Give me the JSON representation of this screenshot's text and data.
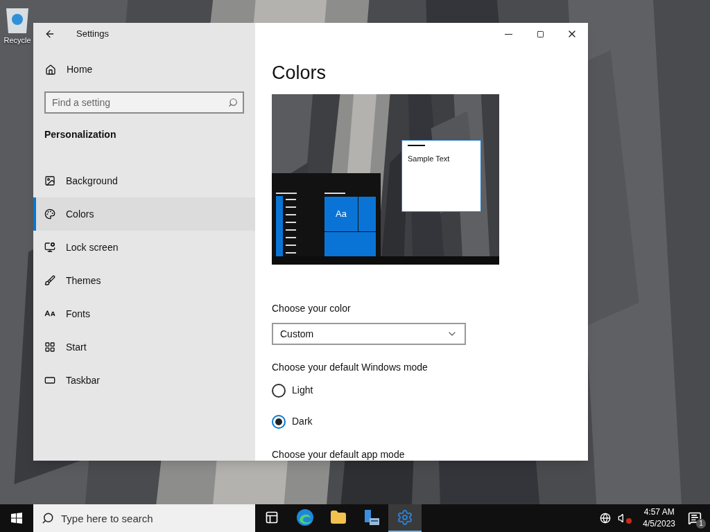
{
  "desktop_icons": [
    {
      "label": "Recycle"
    }
  ],
  "window": {
    "title": "Settings"
  },
  "sidebar": {
    "home": "Home",
    "search": {
      "placeholder": "Find a setting"
    },
    "section": "Personalization",
    "items": [
      {
        "label": "Background",
        "kind": "background",
        "selected": false
      },
      {
        "label": "Colors",
        "kind": "colors",
        "selected": true
      },
      {
        "label": "Lock screen",
        "kind": "lock",
        "selected": false
      },
      {
        "label": "Themes",
        "kind": "themes",
        "selected": false
      },
      {
        "label": "Fonts",
        "kind": "fonts",
        "selected": false
      },
      {
        "label": "Start",
        "kind": "start",
        "selected": false
      },
      {
        "label": "Taskbar",
        "kind": "taskbar",
        "selected": false
      }
    ]
  },
  "content": {
    "title": "Colors",
    "preview": {
      "tile_label": "Aa",
      "sample_text": "Sample Text"
    },
    "color_label": "Choose your color",
    "color_value": "Custom",
    "mode_label": "Choose your default Windows mode",
    "modes": [
      {
        "label": "Light",
        "selected": false
      },
      {
        "label": "Dark",
        "selected": true
      }
    ],
    "next_label": "Choose your default app mode"
  },
  "taskbar": {
    "search_placeholder": "Type here to search",
    "apps": [
      {
        "kind": "taskview",
        "selected": false
      },
      {
        "kind": "edge",
        "selected": false
      },
      {
        "kind": "explorer",
        "selected": false
      },
      {
        "kind": "server",
        "selected": false
      },
      {
        "kind": "settings",
        "selected": true
      }
    ],
    "time": "4:57 AM",
    "date": "4/5/2023",
    "notifications": "1"
  }
}
